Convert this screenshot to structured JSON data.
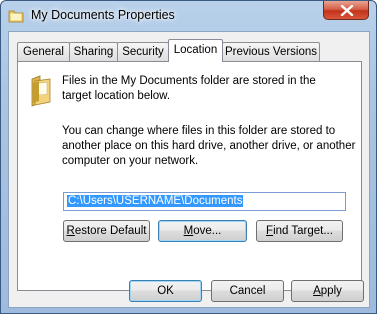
{
  "window": {
    "title": "My Documents Properties"
  },
  "tabs": [
    {
      "label": "General"
    },
    {
      "label": "Sharing"
    },
    {
      "label": "Security"
    },
    {
      "label": "Location"
    },
    {
      "label": "Previous Versions"
    }
  ],
  "active_tab": "Location",
  "location": {
    "intro_line1": "Files in the My Documents folder are stored in the",
    "intro_line2": "target location below.",
    "desc_line1": "You can change where files in this folder are stored to",
    "desc_line2": "another place on this hard drive, another drive, or another",
    "desc_line3": "computer on your network.",
    "path_value": "C:\\Users\\USERNAME\\Documents",
    "restore_default_pre": "",
    "restore_default_ul": "R",
    "restore_default_post": "estore Default",
    "move_pre": "",
    "move_ul": "M",
    "move_post": "ove...",
    "find_target_pre": "",
    "find_target_ul": "F",
    "find_target_post": "ind Target..."
  },
  "footer": {
    "ok": "OK",
    "cancel": "Cancel",
    "apply_ul": "A",
    "apply_post": "pply"
  },
  "icons": {
    "title": "folder-icon",
    "close": "close-icon",
    "location": "folder-icon"
  }
}
